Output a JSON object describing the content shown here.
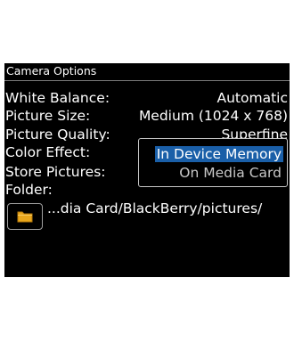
{
  "screen": {
    "title": "Camera Options"
  },
  "rows": {
    "white_balance": {
      "label": "White Balance:",
      "value": "Automatic"
    },
    "picture_size": {
      "label": "Picture Size:",
      "value": "Medium (1024 x 768)"
    },
    "picture_quality": {
      "label": "Picture Quality:",
      "value": "Superfine"
    },
    "color_effect": {
      "label": "Color Effect:"
    },
    "store_pictures": {
      "label": "Store Pictures:"
    },
    "folder": {
      "label": "Folder:",
      "path": "...dia Card/BlackBerry/pictures/"
    }
  },
  "dropdown": {
    "options": [
      "In Device Memory",
      "On Media Card"
    ],
    "selected_index": 0
  },
  "icons": {
    "folder": "folder-icon"
  },
  "colors": {
    "background": "#000000",
    "text": "#ffffff",
    "selection": "#1a5fa8",
    "folder_icon": "#e8a61c"
  }
}
